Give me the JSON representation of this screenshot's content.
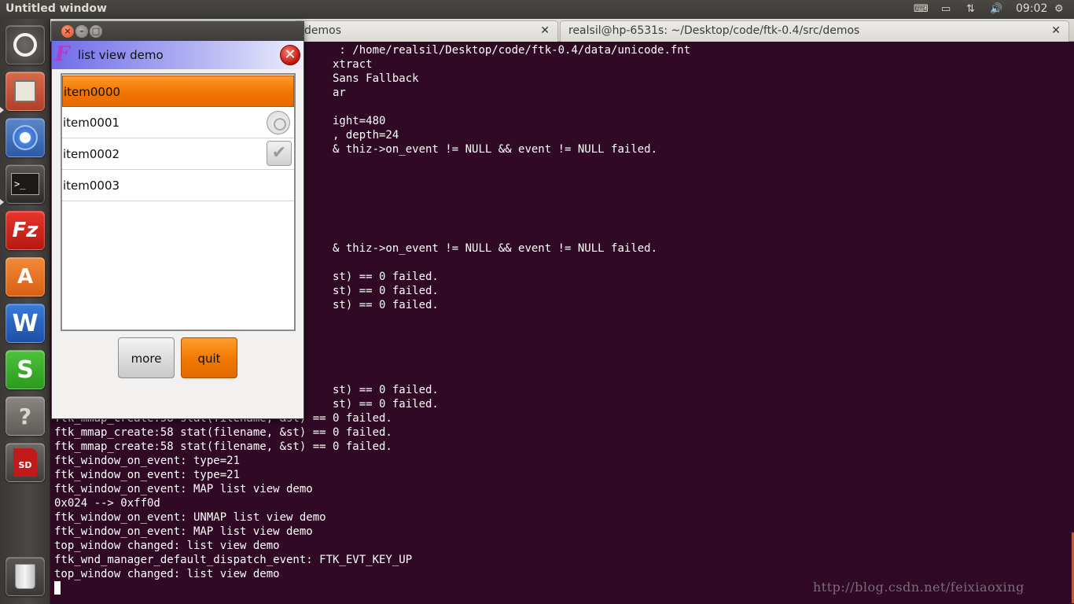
{
  "top_panel": {
    "window_title": "Untitled window",
    "clock": "09:02"
  },
  "launcher": {
    "items": [
      {
        "name": "ubuntu-home-icon",
        "glyph": "◉"
      },
      {
        "name": "file-manager-icon",
        "glyph": "▤"
      },
      {
        "name": "chromium-icon",
        "glyph": "◍"
      },
      {
        "name": "terminal-icon",
        "glyph": ">_"
      },
      {
        "name": "filezilla-icon",
        "glyph": "Fz"
      },
      {
        "name": "software-center-icon",
        "glyph": "A"
      },
      {
        "name": "wps-writer-icon",
        "glyph": "W"
      },
      {
        "name": "wps-spreadsheet-icon",
        "glyph": "S"
      },
      {
        "name": "help-icon",
        "glyph": "?"
      },
      {
        "name": "sd-card-icon",
        "glyph": "SD"
      },
      {
        "name": "trash-icon",
        "glyph": "🗑"
      }
    ]
  },
  "terminal": {
    "tabs": [
      {
        "label": "demos"
      },
      {
        "label": "realsil@hp-6531s: ~/Desktop/code/ftk-0.4/src/demos"
      }
    ],
    "lines": [
      "                                           : /home/realsil/Desktop/code/ftk-0.4/data/unicode.fnt",
      "                                          xtract",
      "                                          Sans Fallback",
      "                                          ar",
      "",
      "                                          ight=480",
      "                                          , depth=24",
      "                                          & thiz->on_event != NULL && event != NULL failed.",
      "",
      "",
      "",
      "",
      "",
      "",
      "                                          & thiz->on_event != NULL && event != NULL failed.",
      "",
      "                                          st) == 0 failed.",
      "                                          st) == 0 failed.",
      "                                          st) == 0 failed.",
      "",
      "",
      "",
      "",
      "",
      "                                          st) == 0 failed.",
      "                                          st) == 0 failed.",
      "ftk_mmap_create:58 stat(filename, &st) == 0 failed.",
      "ftk_mmap_create:58 stat(filename, &st) == 0 failed.",
      "ftk_mmap_create:58 stat(filename, &st) == 0 failed.",
      "ftk_window_on_event: type=21",
      "ftk_window_on_event: type=21",
      "ftk_window_on_event: MAP list view demo",
      "0x024 --> 0xff0d",
      "ftk_window_on_event: UNMAP list view demo",
      "ftk_window_on_event: MAP list view demo",
      "top_window changed: list view demo",
      "ftk_wnd_manager_default_dispatch_event: FTK_EVT_KEY_UP",
      "top_window changed: list view demo"
    ],
    "watermark": "http://blog.csdn.net/feixiaoxing"
  },
  "ftk_window": {
    "logo": "F",
    "title": "list view demo",
    "list_items": [
      {
        "label": "item0000",
        "state": "selected"
      },
      {
        "label": "item0001",
        "state": "radio"
      },
      {
        "label": "item0002",
        "state": "checkbox"
      },
      {
        "label": "item0003",
        "state": "plain"
      }
    ],
    "buttons": {
      "more": "more",
      "quit": "quit"
    }
  },
  "colors": {
    "terminal_bg": "#300a24",
    "accent_orange": "#f07800"
  }
}
